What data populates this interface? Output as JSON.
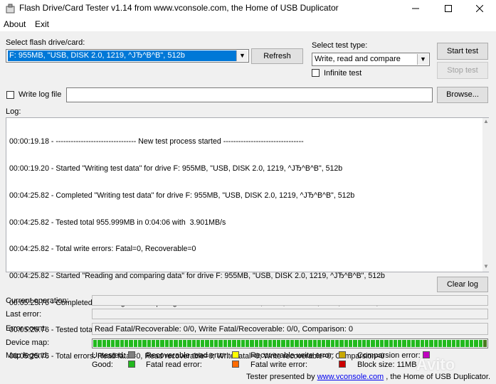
{
  "window": {
    "title": "Flash Drive/Card Tester v1.14 from www.vconsole.com, the Home of USB Duplicator",
    "min_icon": "minimize-icon",
    "max_icon": "maximize-icon",
    "close_icon": "close-icon"
  },
  "menu": {
    "items": [
      "About",
      "Exit"
    ]
  },
  "drive": {
    "label": "Select flash drive/card:",
    "selected": "F: 955MB, \"USB, DISK 2.0, 1219, ^ЈЂ^B^B\", 512b",
    "refresh_label": "Refresh"
  },
  "test_type": {
    "label": "Select test type:",
    "selected": "Write, read and compare",
    "infinite_label": "Infinite test",
    "infinite_checked": false
  },
  "buttons": {
    "start": "Start test",
    "stop": "Stop test",
    "browse": "Browse...",
    "clear_log": "Clear log"
  },
  "write_log": {
    "label": "Write log file",
    "checked": false,
    "path": ""
  },
  "log": {
    "label": "Log:",
    "lines": [
      "00:00:19.18 - -------------------------------- New test process started --------------------------------",
      "00:00:19.20 - Started \"Writing test data\" for drive F: 955MB, \"USB, DISK 2.0, 1219, ^ЈЂ^B^B\", 512b",
      "00:04:25.82 - Completed \"Writing test data\" for drive F: 955MB, \"USB, DISK 2.0, 1219, ^ЈЂ^B^B\", 512b",
      "00:04:25.82 - Tested total 955.999MB in 0:04:06 with  3.901MB/s",
      "00:04:25.82 - Total write errors: Fatal=0, Recoverable=0",
      "00:04:25.82 - Started \"Reading and comparing data\" for drive F: 955MB, \"USB, DISK 2.0, 1219, ^ЈЂ^B^B\", 512b",
      "00:05:25.76 - Completed \"Reading and comparing data\" for drive F: 955MB, \"USB, DISK 2.0, 1219, ^ЈЂ^B^B\", 512b",
      "00:05:25.76 - Tested total 955.999MB in 0:00:59 with 15.977MB/s",
      "00:05:25.76 - Total errors: Read fatal=0, Read recoverable=0; Write fatal=0, Write recoverable=0; Comparsion=0"
    ]
  },
  "status": {
    "current_operation_label": "Current operation:",
    "current_operation": "",
    "last_error_label": "Last error:",
    "last_error": "",
    "error_count_label": "Error count:",
    "error_count": "Read Fatal/Recoverable: 0/0, Write Fatal/Recoverable: 0/0, Comparison: 0",
    "device_map_label": "Device map:",
    "device_map_progress": 1.0
  },
  "legend": {
    "label": "Map legend:",
    "items": [
      {
        "label": "Untested:",
        "color": "#808080"
      },
      {
        "label": "Recoverable read error:",
        "color": "#ffff00"
      },
      {
        "label": "Recoverable write error:",
        "color": "#c8a800"
      },
      {
        "label": "Comparsion error:",
        "color": "#c000c0"
      },
      {
        "label": "Good:",
        "color": "#22b91e"
      },
      {
        "label": "Fatal read error:",
        "color": "#ff6a00"
      },
      {
        "label": "Fatal write error:",
        "color": "#cc0000"
      }
    ],
    "block_size": "Block size: 11MB"
  },
  "footer": {
    "prefix": "Tester presented by",
    "link": "www.vconsole.com",
    "suffix": ", the Home of USB Duplicator."
  },
  "watermark": "Avito"
}
